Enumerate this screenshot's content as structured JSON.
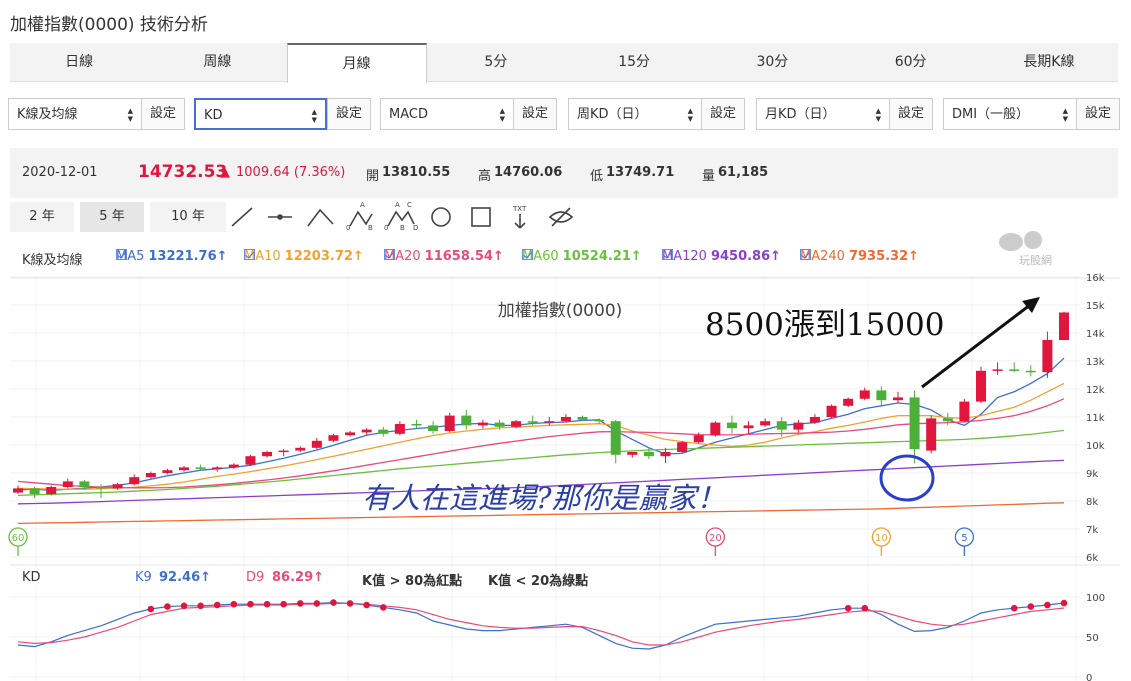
{
  "title": "加權指數(0000) 技術分析",
  "tabs": [
    {
      "label": "日線"
    },
    {
      "label": "周線"
    },
    {
      "label": "月線",
      "active": true
    },
    {
      "label": "5分"
    },
    {
      "label": "15分"
    },
    {
      "label": "30分"
    },
    {
      "label": "60分"
    },
    {
      "label": "長期K線"
    }
  ],
  "selectors": [
    {
      "value": "K線及均線",
      "button": "設定"
    },
    {
      "value": "KD",
      "button": "設定",
      "focused": true
    },
    {
      "value": "MACD",
      "button": "設定"
    },
    {
      "value": "周KD（日）",
      "button": "設定"
    },
    {
      "value": "月KD（日）",
      "button": "設定"
    },
    {
      "value": "DMI（一般）",
      "button": "設定"
    }
  ],
  "quote": {
    "date": "2020-12-01",
    "price": "14732.53",
    "change": "1009.64 (7.36%)",
    "open_label": "開",
    "open": "13810.55",
    "high_label": "高",
    "high": "14760.06",
    "low_label": "低",
    "low": "13749.71",
    "vol_label": "量",
    "vol": "61,185"
  },
  "ranges": [
    {
      "label": "2 年"
    },
    {
      "label": "5 年",
      "active": true
    },
    {
      "label": "10 年"
    }
  ],
  "tool_icons": [
    "line-tool-icon",
    "horizontal-line-tool-icon",
    "angle-tool-icon",
    "abcd-pattern-icon",
    "abcde-pattern-icon",
    "circle-tool-icon",
    "rectangle-tool-icon",
    "text-tool-icon",
    "hide-icon"
  ],
  "tool_glyph_labels": {
    "a": "A",
    "b": "B",
    "c": "C",
    "d": "D",
    "o": "0",
    "txt": "TXT"
  },
  "ma_legend": {
    "label": "K線及均線",
    "items": [
      {
        "name": "MA5",
        "value": "13221.76↑",
        "color": "#3b6fd1"
      },
      {
        "name": "MA10",
        "value": "12203.72↑",
        "color": "#f2a12e"
      },
      {
        "name": "MA20",
        "value": "11658.54↑",
        "color": "#e94a7a"
      },
      {
        "name": "MA60",
        "value": "10524.21↑",
        "color": "#6bbf3c"
      },
      {
        "name": "MA120",
        "value": "9450.86↑",
        "color": "#8a3fc8"
      },
      {
        "name": "MA240",
        "value": "7935.32↑",
        "color": "#f06a30"
      }
    ]
  },
  "watermark": "玩股網",
  "chart_title": "加權指數(0000)",
  "annotation_top": "8500漲到15000",
  "annotation_bottom": "有人在這進場?那你是贏家！",
  "kd_legend": {
    "label": "KD",
    "k_name": "K9",
    "k_value": "92.46↑",
    "k_color": "#3b6fd1",
    "d_name": "D9",
    "d_value": "86.29↑",
    "d_color": "#e94a7a",
    "note1": "K值 > 80為紅點",
    "note2": "K值 < 20為綠點"
  },
  "markers": [
    {
      "label": "60",
      "color": "#6bbf3c",
      "index": 0
    },
    {
      "label": "20",
      "color": "#e94a7a",
      "index": 42
    },
    {
      "label": "10",
      "color": "#f2a12e",
      "index": 52
    },
    {
      "label": "5",
      "color": "#3b6fd1",
      "index": 57
    }
  ],
  "colors": {
    "up": "#e0163d",
    "down": "#4caf38",
    "accent": "#4a6fd4"
  },
  "chart_data": [
    {
      "type": "candlestick",
      "title": "加權指數(0000)",
      "ylim": [
        6000,
        16000
      ],
      "y_ticks": [
        "6k",
        "7k",
        "8k",
        "9k",
        "10k",
        "11k",
        "12k",
        "13k",
        "14k",
        "15k",
        "16k"
      ],
      "candles": [
        [
          8300,
          8550,
          8250,
          8450
        ],
        [
          8450,
          8500,
          8100,
          8250
        ],
        [
          8250,
          8550,
          8200,
          8500
        ],
        [
          8500,
          8800,
          8450,
          8700
        ],
        [
          8700,
          8750,
          8400,
          8500
        ],
        [
          8500,
          8600,
          8100,
          8450
        ],
        [
          8450,
          8650,
          8400,
          8600
        ],
        [
          8600,
          8950,
          8550,
          8850
        ],
        [
          8850,
          9050,
          8800,
          9000
        ],
        [
          9000,
          9150,
          8950,
          9100
        ],
        [
          9100,
          9250,
          9050,
          9200
        ],
        [
          9200,
          9300,
          9100,
          9150
        ],
        [
          9150,
          9250,
          9050,
          9200
        ],
        [
          9200,
          9350,
          9150,
          9300
        ],
        [
          9300,
          9650,
          9250,
          9600
        ],
        [
          9600,
          9800,
          9550,
          9750
        ],
        [
          9750,
          9850,
          9600,
          9800
        ],
        [
          9800,
          9950,
          9750,
          9900
        ],
        [
          9900,
          10250,
          9850,
          10150
        ],
        [
          10150,
          10400,
          10100,
          10350
        ],
        [
          10350,
          10500,
          10300,
          10450
        ],
        [
          10450,
          10600,
          10350,
          10550
        ],
        [
          10550,
          10650,
          10300,
          10400
        ],
        [
          10400,
          10850,
          10350,
          10750
        ],
        [
          10750,
          10900,
          10600,
          10700
        ],
        [
          10700,
          10850,
          10400,
          10500
        ],
        [
          10500,
          11150,
          10450,
          11050
        ],
        [
          11050,
          11250,
          10550,
          10700
        ],
        [
          10700,
          10900,
          10600,
          10800
        ],
        [
          10800,
          10900,
          10550,
          10650
        ],
        [
          10650,
          10900,
          10600,
          10850
        ],
        [
          10850,
          11050,
          10700,
          10800
        ],
        [
          10800,
          11000,
          10700,
          10850
        ],
        [
          10850,
          11100,
          10800,
          11000
        ],
        [
          11000,
          11050,
          10850,
          10900
        ],
        [
          10900,
          10950,
          10750,
          10850
        ],
        [
          10850,
          10900,
          9350,
          9650
        ],
        [
          9650,
          9750,
          9550,
          9750
        ],
        [
          9750,
          9900,
          9500,
          9600
        ],
        [
          9600,
          9900,
          9350,
          9750
        ],
        [
          9750,
          10150,
          9700,
          10100
        ],
        [
          10100,
          10450,
          10050,
          10350
        ],
        [
          10350,
          10850,
          10300,
          10800
        ],
        [
          10800,
          11050,
          10400,
          10600
        ],
        [
          10600,
          10850,
          10400,
          10700
        ],
        [
          10700,
          10950,
          10650,
          10850
        ],
        [
          10850,
          11000,
          10300,
          10550
        ],
        [
          10550,
          10900,
          10450,
          10800
        ],
        [
          10800,
          11100,
          10750,
          11000
        ],
        [
          11000,
          11450,
          10950,
          11400
        ],
        [
          11400,
          11700,
          11350,
          11650
        ],
        [
          11650,
          12050,
          11600,
          11950
        ],
        [
          11950,
          12100,
          11400,
          11600
        ],
        [
          11600,
          11900,
          11500,
          11700
        ],
        [
          11700,
          11950,
          9350,
          9850
        ],
        [
          9800,
          11050,
          9700,
          10950
        ],
        [
          10950,
          11150,
          10700,
          10850
        ],
        [
          10850,
          11650,
          10800,
          11550
        ],
        [
          11550,
          12800,
          11500,
          12650
        ],
        [
          12650,
          12950,
          12500,
          12700
        ],
        [
          12700,
          12950,
          12600,
          12650
        ],
        [
          12650,
          12850,
          12450,
          12600
        ],
        [
          12600,
          14050,
          12400,
          13750
        ],
        [
          13750,
          14760,
          13750,
          14732
        ]
      ],
      "ma5": [
        8400,
        8420,
        8380,
        8420,
        8460,
        8500,
        8560,
        8650,
        8780,
        8900,
        9000,
        9100,
        9150,
        9200,
        9280,
        9400,
        9530,
        9670,
        9820,
        9990,
        10170,
        10350,
        10450,
        10520,
        10590,
        10630,
        10700,
        10750,
        10770,
        10700,
        10700,
        10770,
        10800,
        10820,
        10880,
        10900,
        10500,
        10200,
        9900,
        9680,
        9700,
        9900,
        10100,
        10250,
        10400,
        10550,
        10700,
        10750,
        10800,
        10950,
        11100,
        11300,
        11400,
        11500,
        11450,
        11250,
        10900,
        10700,
        11100,
        11700,
        11900,
        12200,
        12550,
        13100
      ],
      "ma10": [
        8450,
        8440,
        8430,
        8420,
        8420,
        8440,
        8460,
        8490,
        8540,
        8600,
        8680,
        8780,
        8880,
        8960,
        9050,
        9150,
        9250,
        9360,
        9480,
        9600,
        9720,
        9850,
        9970,
        10100,
        10220,
        10340,
        10430,
        10500,
        10560,
        10610,
        10640,
        10670,
        10700,
        10720,
        10740,
        10760,
        10700,
        10500,
        10350,
        10200,
        10120,
        10050,
        10000,
        9950,
        10000,
        10100,
        10250,
        10380,
        10480,
        10600,
        10700,
        10820,
        10950,
        11050,
        11050,
        11050,
        10980,
        10950,
        11050,
        11200,
        11350,
        11600,
        11900,
        12200
      ],
      "ma20": [
        8700,
        8650,
        8600,
        8550,
        8520,
        8500,
        8480,
        8470,
        8470,
        8480,
        8500,
        8540,
        8580,
        8630,
        8690,
        8750,
        8820,
        8900,
        8990,
        9080,
        9180,
        9280,
        9380,
        9480,
        9580,
        9680,
        9780,
        9880,
        9970,
        10060,
        10140,
        10220,
        10300,
        10360,
        10420,
        10470,
        10480,
        10460,
        10450,
        10430,
        10400,
        10370,
        10360,
        10360,
        10380,
        10400,
        10410,
        10420,
        10440,
        10460,
        10500,
        10560,
        10640,
        10720,
        10760,
        10780,
        10800,
        10830,
        10880,
        10950,
        11050,
        11200,
        11400,
        11650
      ],
      "ma60": [
        8200,
        8220,
        8240,
        8260,
        8280,
        8300,
        8320,
        8350,
        8380,
        8410,
        8450,
        8490,
        8530,
        8580,
        8630,
        8680,
        8730,
        8790,
        8850,
        8910,
        8970,
        9030,
        9090,
        9150,
        9200,
        9250,
        9300,
        9350,
        9400,
        9450,
        9500,
        9550,
        9600,
        9650,
        9690,
        9730,
        9760,
        9790,
        9820,
        9840,
        9860,
        9880,
        9900,
        9920,
        9940,
        9960,
        9980,
        10000,
        10020,
        10040,
        10060,
        10080,
        10100,
        10120,
        10140,
        10160,
        10180,
        10200,
        10240,
        10280,
        10330,
        10380,
        10450,
        10520
      ],
      "ma120": [
        7900,
        7910,
        7920,
        7940,
        7960,
        7980,
        8000,
        8020,
        8040,
        8060,
        8080,
        8100,
        8120,
        8140,
        8160,
        8180,
        8200,
        8220,
        8240,
        8260,
        8280,
        8300,
        8320,
        8340,
        8360,
        8380,
        8400,
        8420,
        8440,
        8460,
        8480,
        8500,
        8530,
        8560,
        8590,
        8620,
        8650,
        8680,
        8710,
        8740,
        8770,
        8800,
        8830,
        8860,
        8890,
        8920,
        8950,
        8980,
        9010,
        9040,
        9070,
        9100,
        9130,
        9160,
        9190,
        9220,
        9250,
        9280,
        9310,
        9340,
        9370,
        9400,
        9430,
        9450
      ],
      "ma240": [
        7200,
        7210,
        7220,
        7230,
        7240,
        7250,
        7260,
        7270,
        7280,
        7290,
        7300,
        7310,
        7320,
        7330,
        7340,
        7350,
        7360,
        7370,
        7380,
        7390,
        7400,
        7410,
        7420,
        7430,
        7440,
        7450,
        7460,
        7470,
        7480,
        7490,
        7500,
        7510,
        7520,
        7530,
        7540,
        7550,
        7560,
        7570,
        7580,
        7590,
        7600,
        7610,
        7620,
        7630,
        7640,
        7650,
        7660,
        7670,
        7680,
        7690,
        7700,
        7710,
        7720,
        7740,
        7760,
        7780,
        7800,
        7820,
        7840,
        7860,
        7880,
        7900,
        7920,
        7935
      ]
    },
    {
      "type": "line",
      "title": "KD",
      "ylim": [
        0,
        100
      ],
      "y_ticks": [
        "0",
        "50",
        "100"
      ],
      "series": [
        {
          "name": "K9",
          "values": [
            40,
            38,
            44,
            52,
            58,
            64,
            72,
            80,
            85,
            88,
            89,
            89,
            90,
            91,
            91,
            91,
            91,
            92,
            92,
            93,
            92,
            90,
            87,
            84,
            80,
            70,
            65,
            60,
            58,
            58,
            60,
            62,
            64,
            66,
            62,
            52,
            42,
            36,
            35,
            40,
            50,
            58,
            66,
            68,
            70,
            72,
            74,
            76,
            80,
            84,
            86,
            86,
            78,
            66,
            57,
            58,
            62,
            70,
            80,
            84,
            86,
            88,
            90,
            92.46
          ]
        },
        {
          "name": "D9",
          "values": [
            44,
            42,
            43,
            46,
            50,
            56,
            62,
            70,
            78,
            82,
            86,
            87,
            88,
            89,
            90,
            90,
            90,
            91,
            91,
            92,
            92,
            91,
            89,
            87,
            84,
            78,
            72,
            68,
            64,
            62,
            61,
            61,
            62,
            63,
            63,
            58,
            52,
            44,
            40,
            40,
            44,
            50,
            56,
            60,
            64,
            67,
            70,
            72,
            75,
            78,
            81,
            83,
            82,
            76,
            70,
            66,
            64,
            66,
            70,
            74,
            78,
            82,
            84,
            86.29
          ]
        }
      ]
    }
  ]
}
